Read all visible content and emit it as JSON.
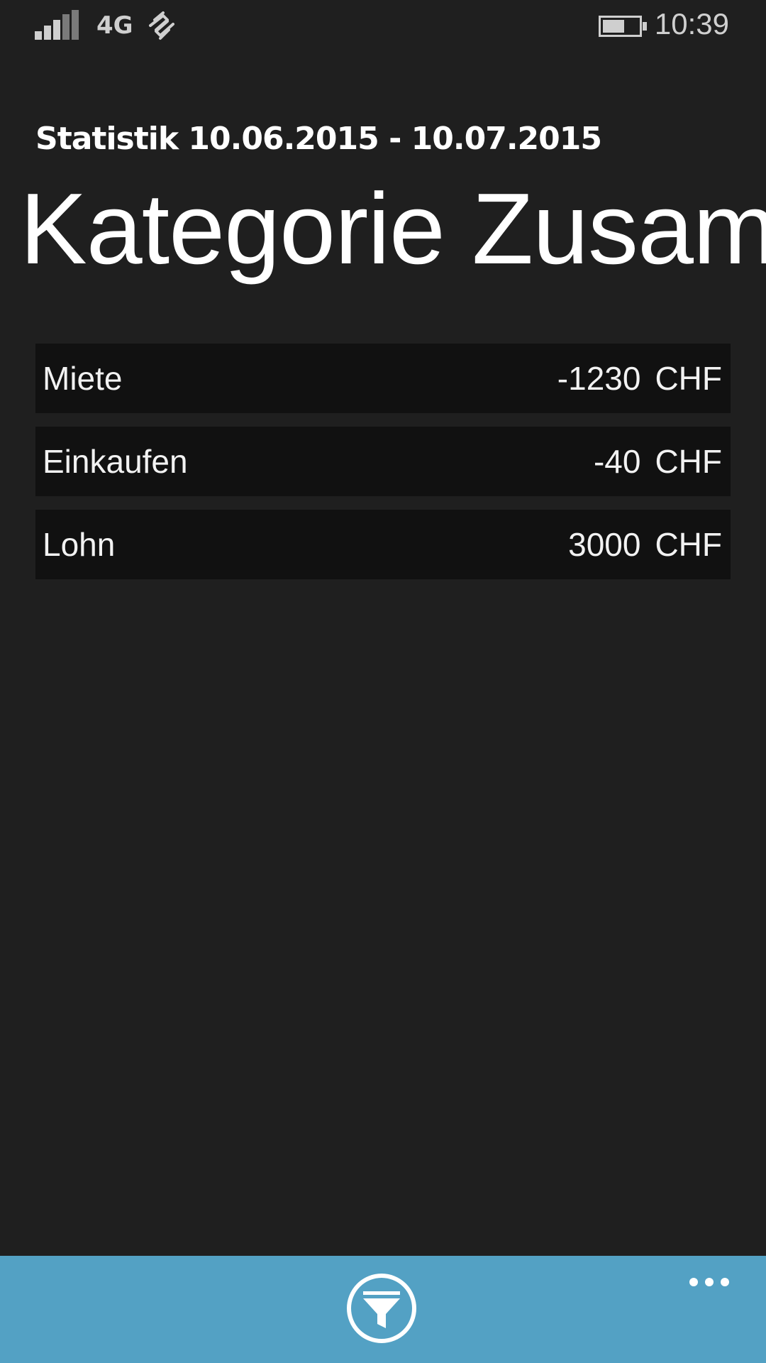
{
  "status_bar": {
    "network": "4G",
    "time": "10:39",
    "icons": [
      "signal-strength-icon",
      "data-transfer-icon",
      "battery-icon"
    ]
  },
  "header": {
    "subtitle": "Statistik 10.06.2015 - 10.07.2015",
    "title": "Kategorie Zusam"
  },
  "categories": [
    {
      "name": "Miete",
      "amount": "-1230",
      "currency": "CHF"
    },
    {
      "name": "Einkaufen",
      "amount": "-40",
      "currency": "CHF"
    },
    {
      "name": "Lohn",
      "amount": "3000",
      "currency": "CHF"
    }
  ],
  "app_bar": {
    "icons": [
      "filter-icon",
      "more-options-icon"
    ],
    "color": "#53a1c4"
  }
}
